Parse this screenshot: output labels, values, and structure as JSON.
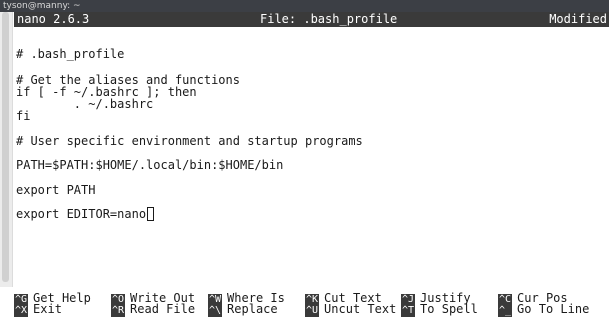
{
  "window": {
    "title": "tyson@manny: ~"
  },
  "header": {
    "version": "nano 2.6.3",
    "file": "File: .bash_profile",
    "status": "Modified"
  },
  "editor": {
    "lines": [
      "# .bash_profile",
      "",
      "# Get the aliases and functions",
      "if [ -f ~/.bashrc ]; then",
      "        . ~/.bashrc",
      "fi",
      "",
      "# User specific environment and startup programs",
      "",
      "PATH=$PATH:$HOME/.local/bin:$HOME/bin",
      "",
      "export PATH",
      "",
      "export EDITOR=nano"
    ]
  },
  "shortcuts": {
    "row1": [
      {
        "key": "^G",
        "label": "Get Help"
      },
      {
        "key": "^O",
        "label": "Write Out"
      },
      {
        "key": "^W",
        "label": "Where Is"
      },
      {
        "key": "^K",
        "label": "Cut Text"
      },
      {
        "key": "^J",
        "label": "Justify"
      },
      {
        "key": "^C",
        "label": "Cur Pos"
      }
    ],
    "row2": [
      {
        "key": "^X",
        "label": "Exit"
      },
      {
        "key": "^R",
        "label": "Read File"
      },
      {
        "key": "^\\",
        "label": "Replace"
      },
      {
        "key": "^U",
        "label": "Uncut Text"
      },
      {
        "key": "^T",
        "label": "To Spell"
      },
      {
        "key": "^_",
        "label": "Go To Line"
      }
    ]
  }
}
